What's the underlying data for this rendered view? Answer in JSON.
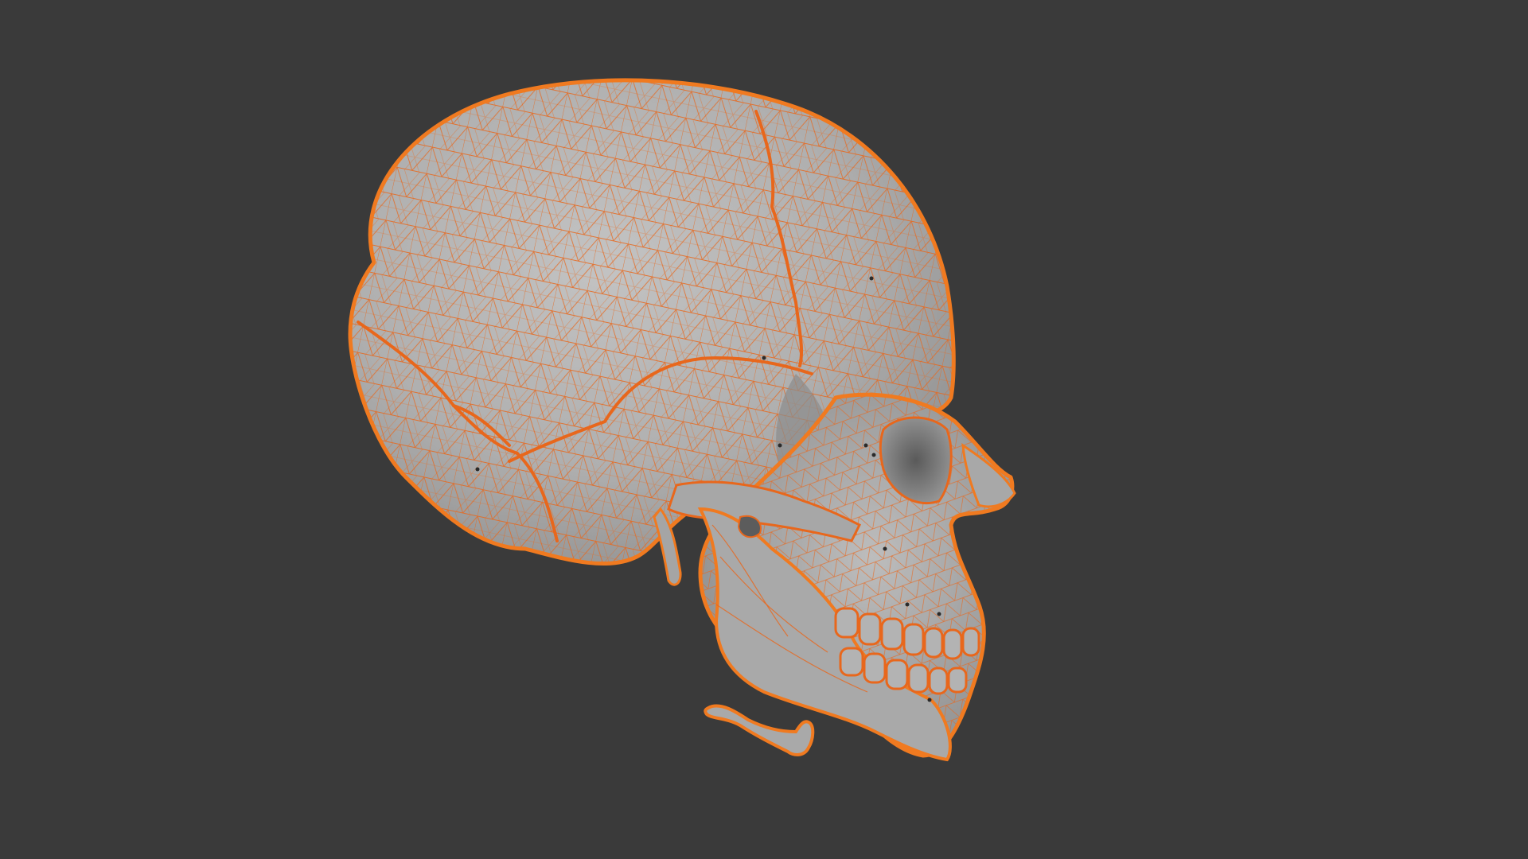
{
  "viewport": {
    "background_color": "#3a3a3a",
    "mesh_fill_color": "#b4b4b4",
    "mesh_shadow_color": "#8e8e8e",
    "wireframe_color": "#e8671c",
    "selected_outline_color": "#f07a20",
    "subject": "skull-mesh-wireframe"
  }
}
